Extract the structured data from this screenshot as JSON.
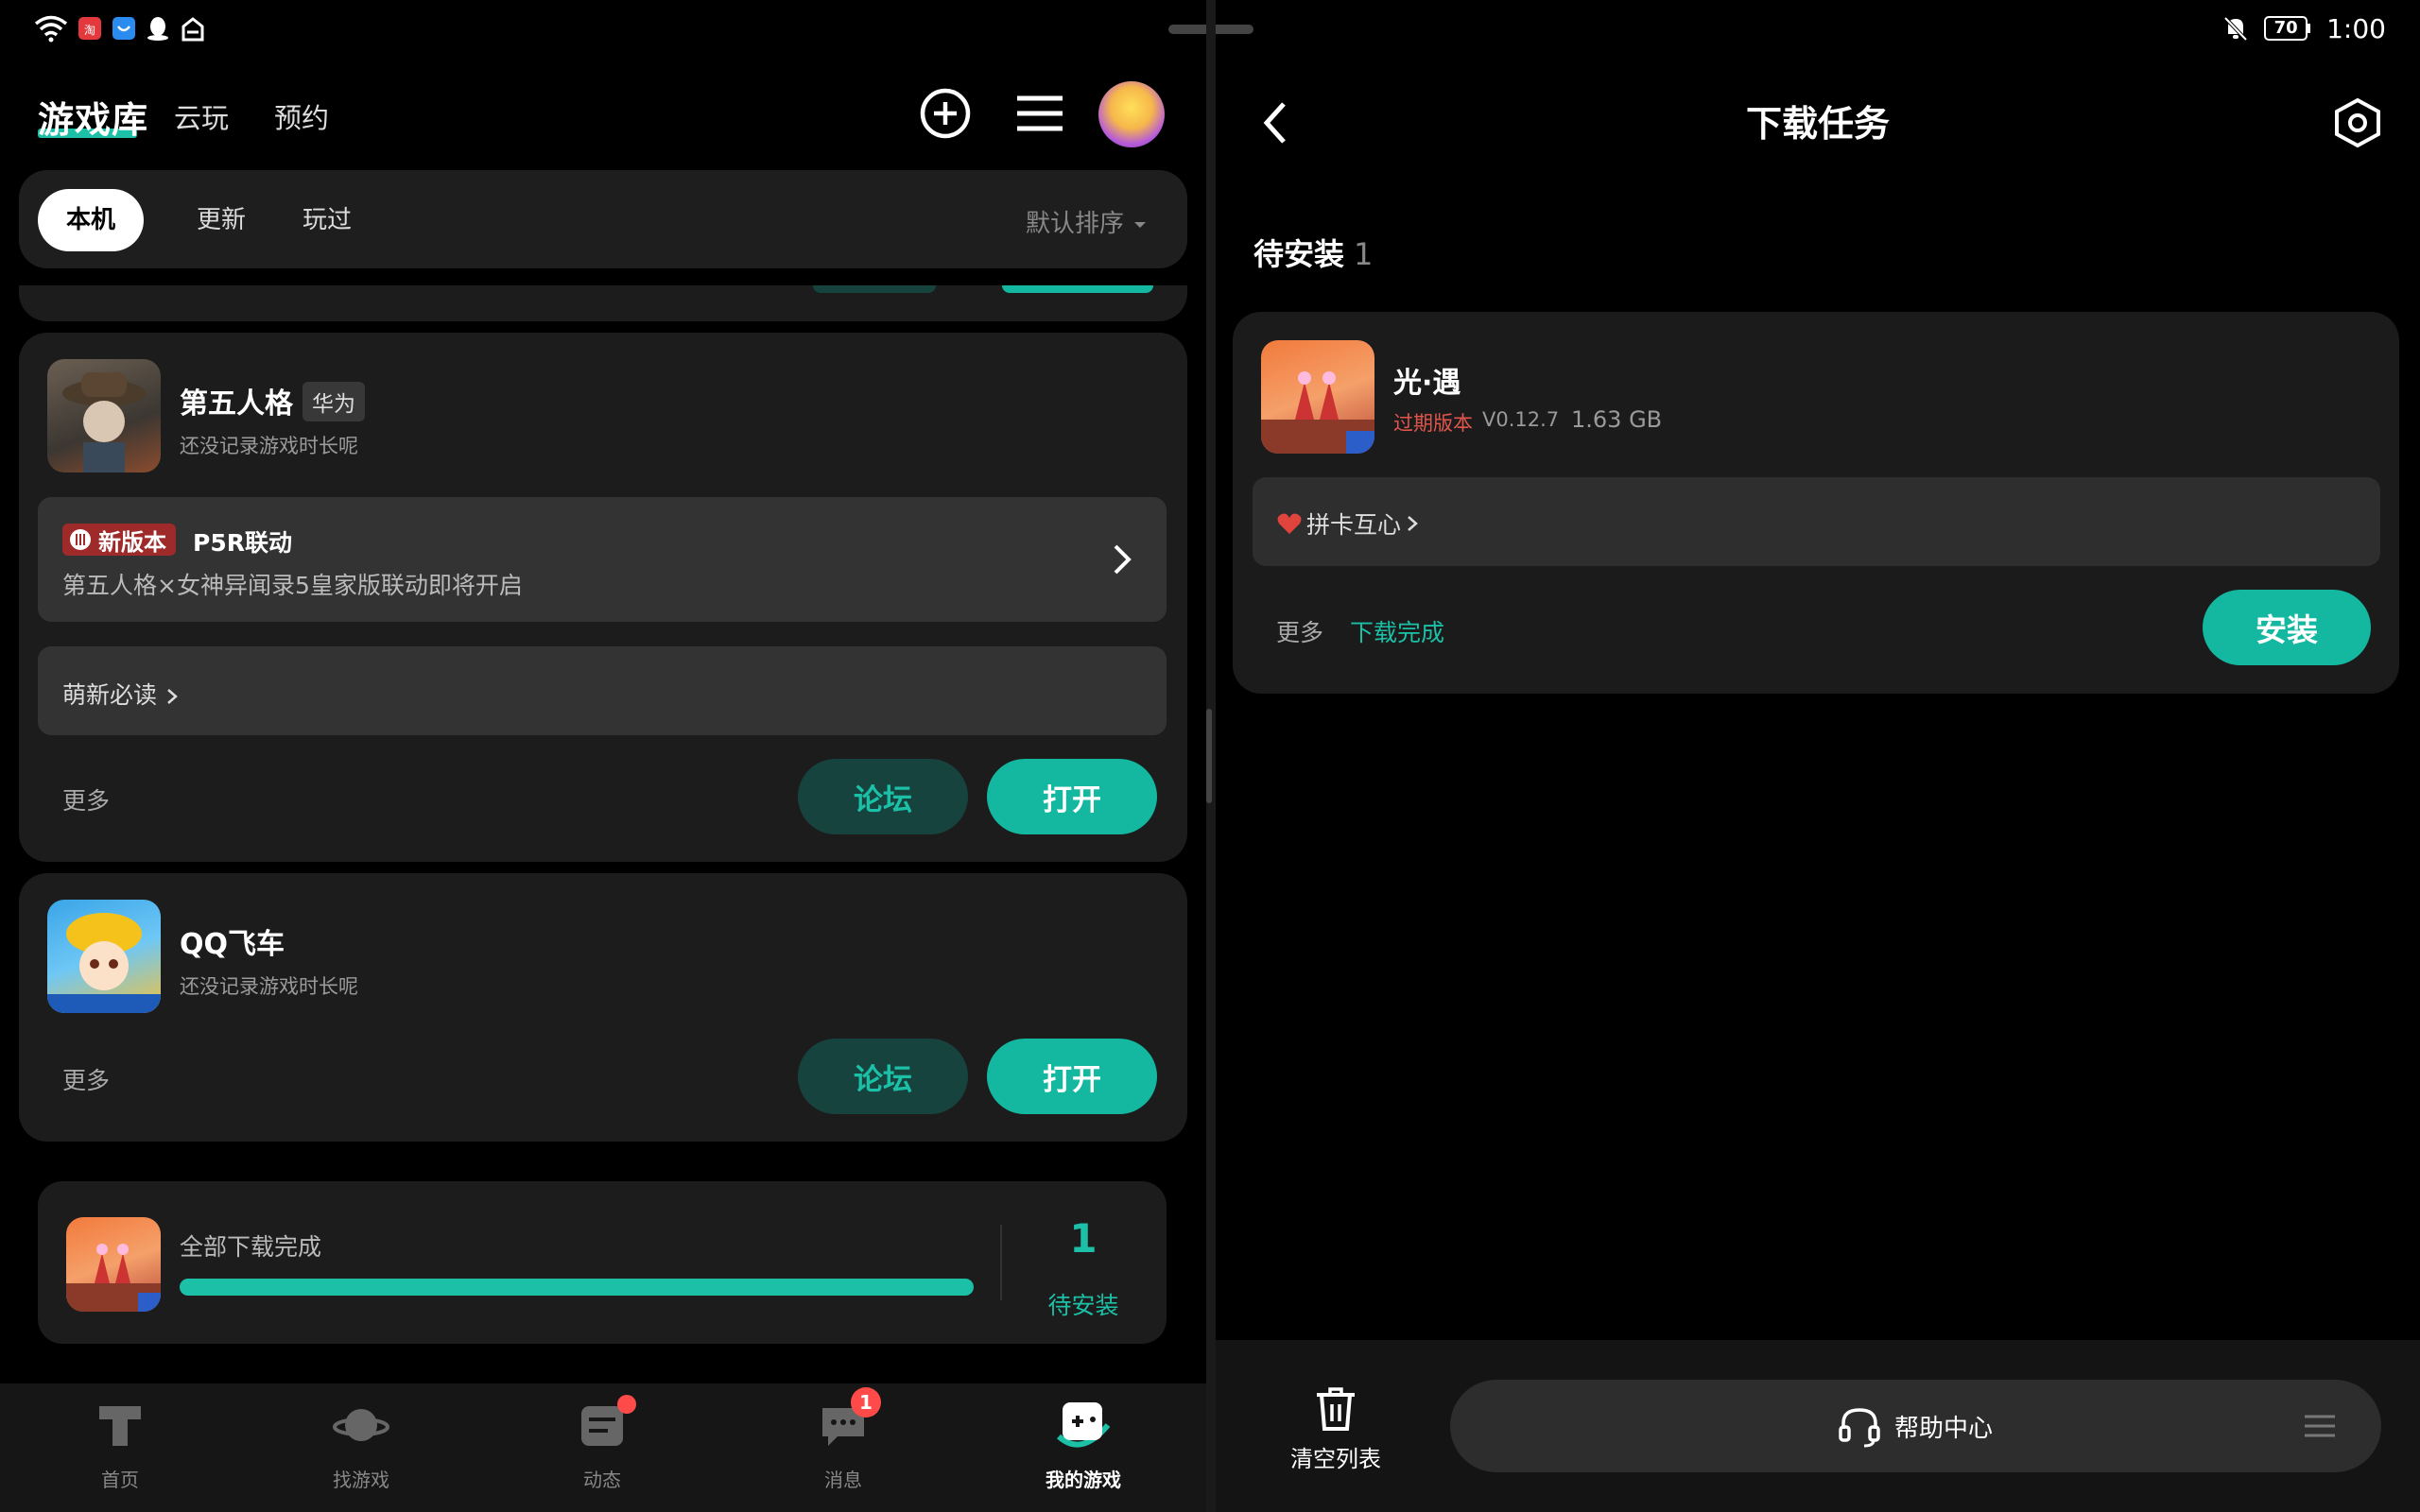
{
  "status_bar": {
    "left_icons": [
      "wifi-icon",
      "app-notification-icon",
      "message-app-icon",
      "qq-icon",
      "cloud-icon"
    ],
    "battery": "70",
    "time": "1:00"
  },
  "left": {
    "brand": "游戏库",
    "nav": [
      "云玩",
      "预约"
    ],
    "filters": [
      "本机",
      "更新",
      "玩过"
    ],
    "sort_label": "默认排序",
    "games": [
      {
        "name": "第五人格",
        "tag": "华为",
        "playtime": "还没记录游戏时长呢",
        "news_badge": "新版本",
        "news_title": "P5R联动",
        "news_desc": "第五人格×女神异闻录5皇家版联动即将开启",
        "guide": "萌新必读",
        "more": "更多",
        "forum": "论坛",
        "open": "打开"
      },
      {
        "name": "QQ飞车",
        "playtime": "还没记录游戏时长呢",
        "more": "更多",
        "forum": "论坛",
        "open": "打开"
      }
    ],
    "download": {
      "status": "全部下载完成",
      "progress": 1.0,
      "count": "1",
      "count_label": "待安装"
    },
    "bottom_nav": [
      {
        "label": "首页",
        "icon": "home-icon"
      },
      {
        "label": "找游戏",
        "icon": "planet-icon"
      },
      {
        "label": "动态",
        "icon": "feed-icon"
      },
      {
        "label": "消息",
        "icon": "chat-icon",
        "badge": "1"
      },
      {
        "label": "我的游戏",
        "icon": "my-games-icon",
        "active": true
      }
    ]
  },
  "right": {
    "title": "下载任务",
    "section": "待安装",
    "section_count": "1",
    "task": {
      "name": "光·遇",
      "expired": "过期版本",
      "version": "V0.12.7",
      "size": "1.63 GB",
      "event": "拼卡互心",
      "more": "更多",
      "status": "下载完成",
      "install": "安装"
    },
    "clear": "清空列表",
    "help": "帮助中心"
  },
  "colors": {
    "accent": "#14b8a0",
    "accent_dark": "#17433f",
    "expired": "#e0564d",
    "badge": "#ff4a4a"
  }
}
